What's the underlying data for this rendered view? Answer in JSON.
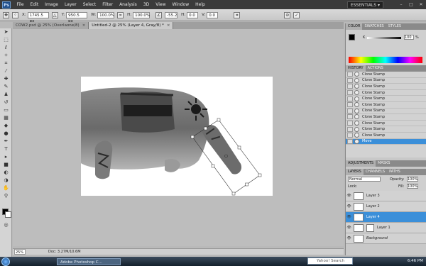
{
  "app": {
    "logo": "Ps"
  },
  "menu": [
    "File",
    "Edit",
    "Image",
    "Layer",
    "Select",
    "Filter",
    "Analysis",
    "3D",
    "View",
    "Window",
    "Help"
  ],
  "workspace_label": "ESSENTIALS ▾",
  "window_controls": [
    "–",
    "□",
    "✕"
  ],
  "options": {
    "x_label": "X:",
    "x_value": "1745.5 px",
    "y_label": "Y:",
    "y_value": "950.5 px",
    "w_label": "W:",
    "w_value": "100.0%",
    "h_label": "H:",
    "h_value": "100.0%",
    "angle_value": "-55.2",
    "hskew_label": "H:",
    "hskew_value": "0.0",
    "vskew_label": "V:",
    "vskew_value": "0.0"
  },
  "tabs": [
    {
      "label": "COW2.psd @ 25% (Overlaone/8)"
    },
    {
      "label": "Untitled-2 @ 25% (Layer 4, Gray/8) *"
    }
  ],
  "status": {
    "zoom": "25%",
    "doc": "Doc: 3.27M/10.6M"
  },
  "color_panel": {
    "tabs": [
      "COLOR",
      "SWATCHES",
      "STYLES"
    ],
    "k_label": "K",
    "k_value": "100",
    "k_unit": "%"
  },
  "history_panel": {
    "tabs": [
      "HISTORY",
      "ACTIONS"
    ],
    "items": [
      "Clone Stamp",
      "Clone Stamp",
      "Clone Stamp",
      "Clone Stamp",
      "Clone Stamp",
      "Clone Stamp",
      "Clone Stamp",
      "Clone Stamp",
      "Clone Stamp",
      "Clone Stamp",
      "Clone Stamp",
      "Move"
    ],
    "selected_index": 11
  },
  "adjust_panel": {
    "tabs": [
      "ADJUSTMENTS",
      "MASKS"
    ]
  },
  "layers_panel": {
    "tabs": [
      "LAYERS",
      "CHANNELS",
      "PATHS"
    ],
    "blend_mode": "Normal",
    "opacity_label": "Opacity:",
    "opacity_value": "100%",
    "lock_label": "Lock:",
    "fill_label": "Fill:",
    "fill_value": "100%",
    "layers": [
      {
        "name": "Layer 3"
      },
      {
        "name": "Layer 2"
      },
      {
        "name": "Layer 4"
      },
      {
        "name": "Layer 1"
      },
      {
        "name": "Background"
      }
    ],
    "selected_index": 2
  },
  "taskbar": {
    "task": "Adobe Photoshop C...",
    "search": "Yahoo! Search",
    "clock": "6:46 PM"
  },
  "colors": {
    "selection": "#3b8fd9",
    "menubar": "#3a3a3a"
  }
}
